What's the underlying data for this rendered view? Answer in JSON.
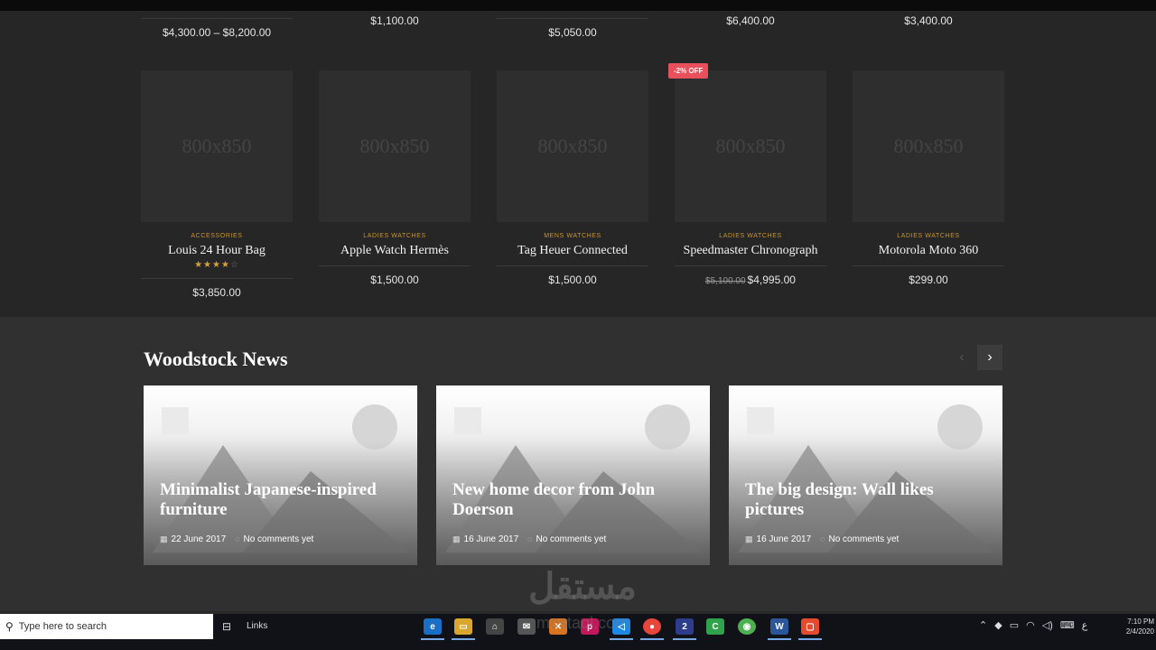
{
  "previous_row": [
    {
      "price": "$4,300.00 – $8,200.00"
    },
    {
      "price": "$1,100.00"
    },
    {
      "price": "$5,050.00"
    },
    {
      "price": "$6,400.00"
    },
    {
      "price": "$3,400.00"
    }
  ],
  "products": [
    {
      "placeholder": "800x850",
      "category": "ACCESSORIES",
      "name": "Louis 24 Hour Bag",
      "rating": 4,
      "old_price": "",
      "price": "$3,850.00",
      "badge": ""
    },
    {
      "placeholder": "800x850",
      "category": "LADIES WATCHES",
      "name": "Apple Watch Hermès",
      "rating": 0,
      "old_price": "",
      "price": "$1,500.00",
      "badge": ""
    },
    {
      "placeholder": "800x850",
      "category": "MENS WATCHES",
      "name": "Tag Heuer Connected",
      "rating": 0,
      "old_price": "",
      "price": "$1,500.00",
      "badge": ""
    },
    {
      "placeholder": "800x850",
      "category": "LADIES WATCHES",
      "name": "Speedmaster Chronograph",
      "rating": 0,
      "old_price": "$5,100.00",
      "price": "$4,995.00",
      "badge": "-2% OFF"
    },
    {
      "placeholder": "800x850",
      "category": "LADIES WATCHES",
      "name": "Motorola Moto 360",
      "rating": 0,
      "old_price": "",
      "price": "$299.00",
      "badge": ""
    }
  ],
  "news": {
    "title": "Woodstock News",
    "posts": [
      {
        "title": "Minimalist Japanese-inspired furniture",
        "date": "22 June 2017",
        "comments": "No comments yet"
      },
      {
        "title": "New home decor from John Doerson",
        "date": "16 June 2017",
        "comments": "No comments yet"
      },
      {
        "title": "The big design: Wall likes pictures",
        "date": "16 June 2017",
        "comments": "No comments yet"
      }
    ]
  },
  "watermark": {
    "arabic": "مستقل",
    "latin": "mostaql.com"
  },
  "taskbar": {
    "search_placeholder": "Type here to search",
    "links_label": "Links",
    "time": "7:10 PM",
    "date": "2/4/2020",
    "lang": "ع"
  },
  "colors": {
    "accent": "#c9952f",
    "badge": "#e8505b",
    "stars": "#d4a23b"
  }
}
